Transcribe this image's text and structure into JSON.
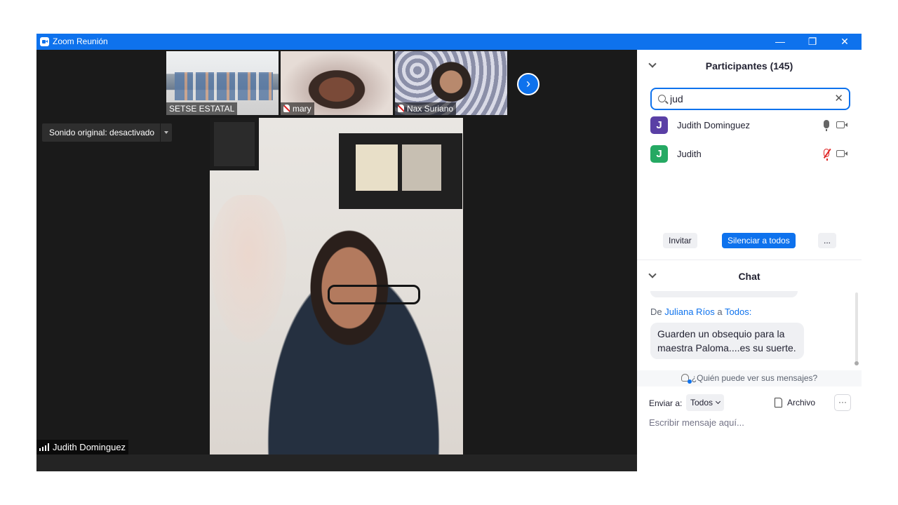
{
  "window": {
    "title": "Zoom Reunión",
    "minimize": "—",
    "maximize": "❐",
    "close": "✕"
  },
  "meeting": {
    "strip": [
      {
        "name": "SETSE ESTATAL",
        "muted": false
      },
      {
        "name": "mary",
        "muted": true
      },
      {
        "name": "Nax Suriano",
        "muted": true
      }
    ],
    "next_label": "›",
    "sound_button": "Sonido original: desactivado",
    "active_speaker": "Judith Dominguez"
  },
  "participants": {
    "title": "Participantes (145)",
    "search_value": "jud",
    "clear": "✕",
    "list": [
      {
        "initial": "J",
        "name": "Judith Dominguez",
        "avatar_color": "#5a3fa5",
        "mic": "on"
      },
      {
        "initial": "J",
        "name": "Judith",
        "avatar_color": "#25a963",
        "mic": "muted"
      }
    ],
    "buttons": {
      "invite": "Invitar",
      "mute_all": "Silenciar a todos",
      "more": "..."
    }
  },
  "chat": {
    "title": "Chat",
    "from_prefix": "De",
    "sender": "Juliana Ríos",
    "to_text": "a",
    "recipient": "Todos:",
    "message": "Guarden un obsequio para la maestra Paloma....es su suerte.",
    "who_sees": "¿Quién puede ver sus mensajes?",
    "send_to_label": "Enviar a:",
    "send_to_value": "Todos",
    "file_label": "Archivo",
    "more": "···",
    "input_placeholder": "Escribir mensaje aquí..."
  },
  "colors": {
    "accent": "#0e72ed",
    "muted_red": "#e02828"
  }
}
